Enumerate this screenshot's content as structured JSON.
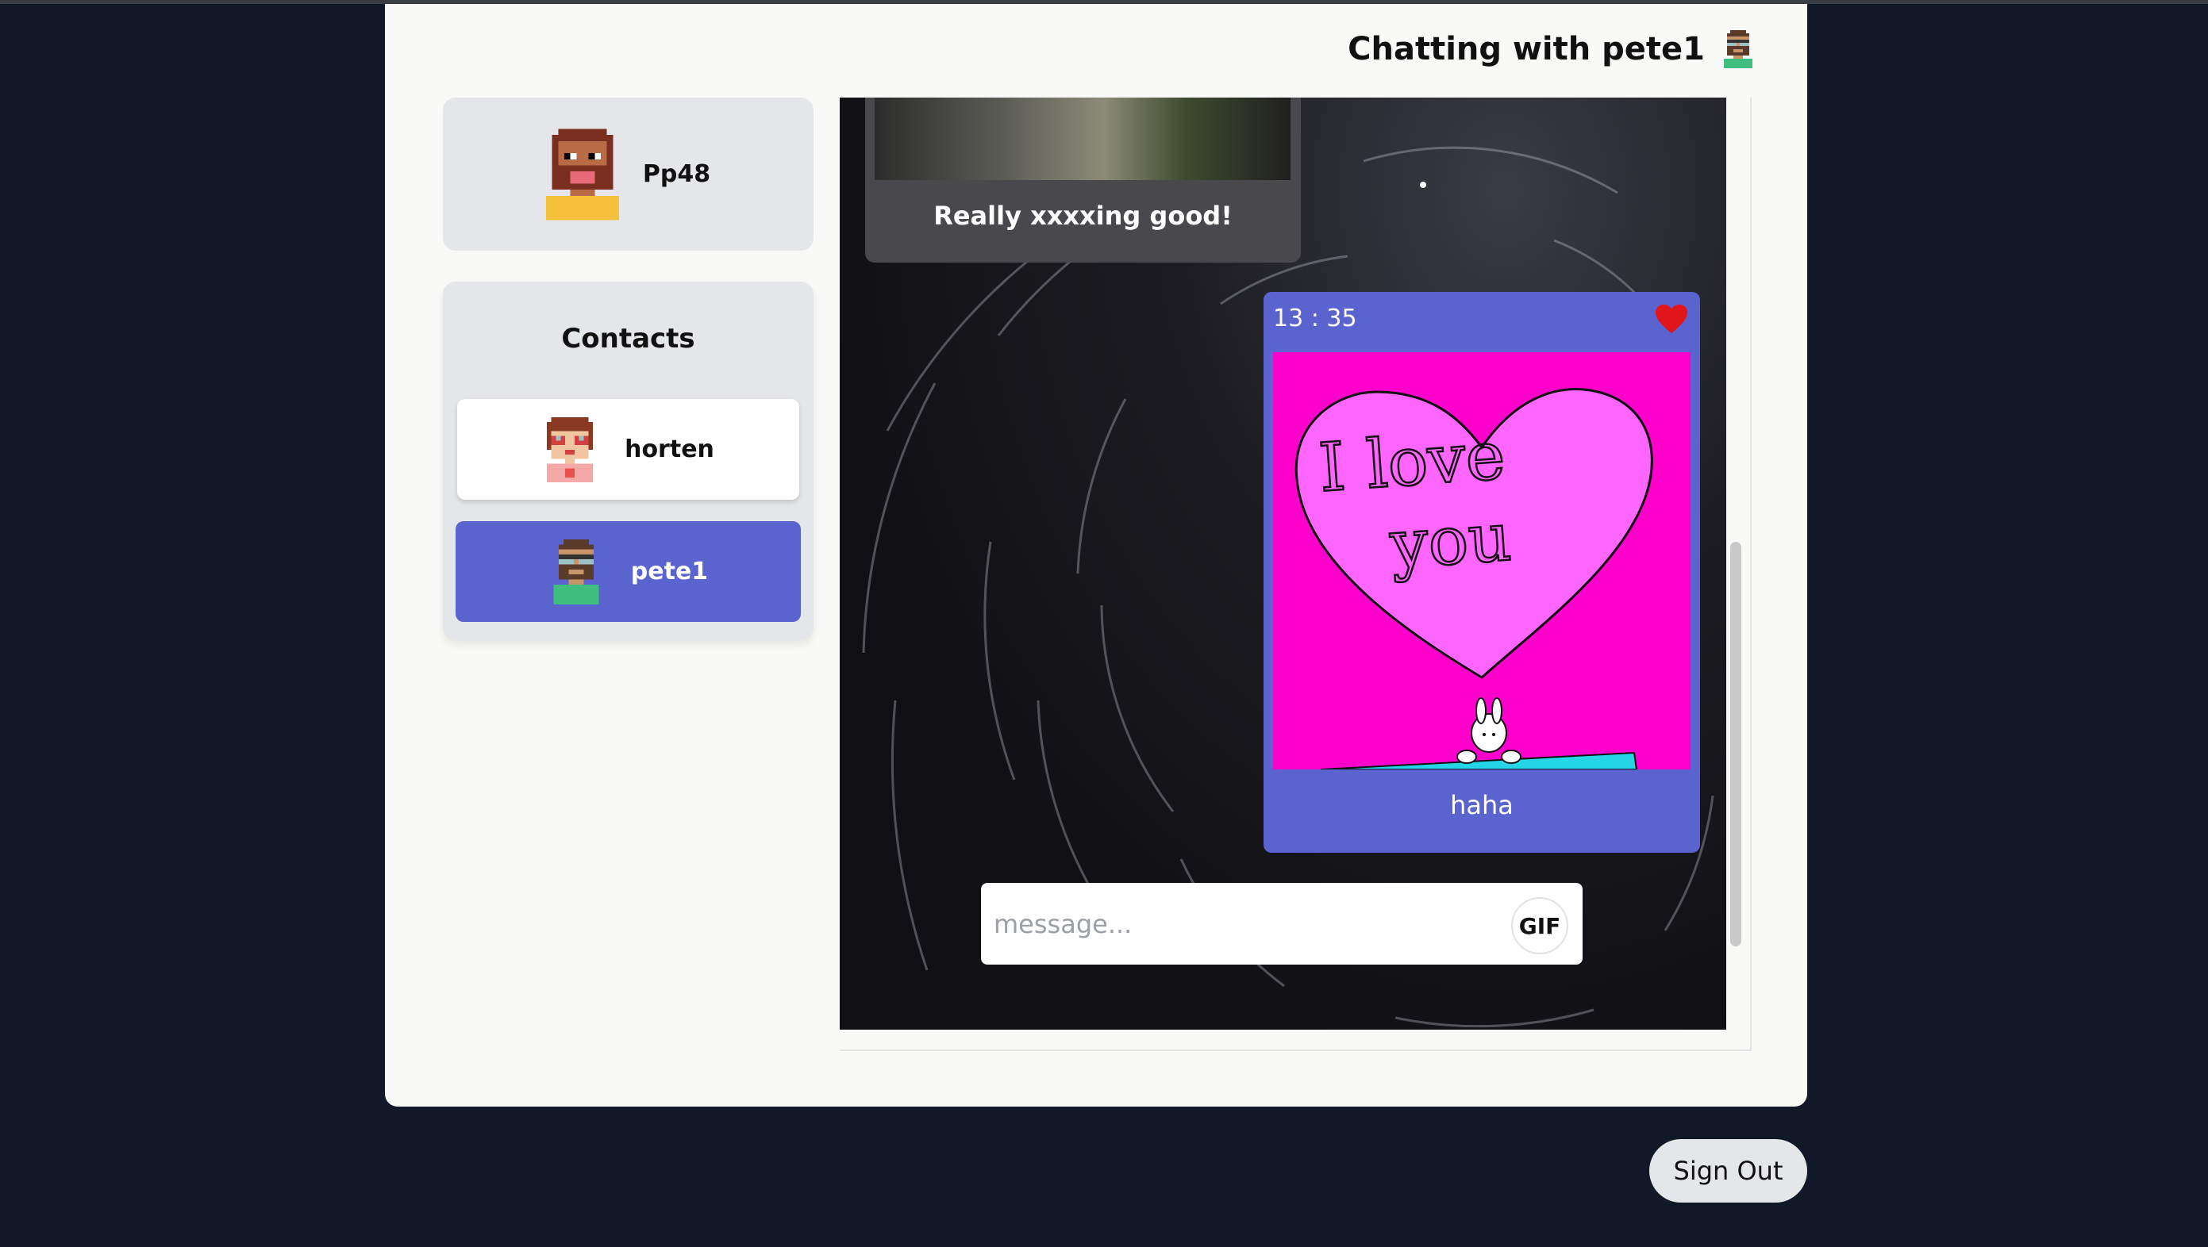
{
  "header": {
    "chat_title": "Chatting with pete1"
  },
  "profile": {
    "username": "Pp48"
  },
  "contacts": {
    "title": "Contacts",
    "items": [
      {
        "name": "horten",
        "selected": false
      },
      {
        "name": "pete1",
        "selected": true
      }
    ]
  },
  "messages": [
    {
      "text": "Really xxxxing good!"
    },
    {
      "time": "13 : 35",
      "caption": "haha",
      "liked": true,
      "gif_text_1": "I love",
      "gif_text_2": "you"
    }
  ],
  "composer": {
    "placeholder": "message...",
    "gif_label": "GIF"
  },
  "sign_out_label": "Sign Out",
  "colors": {
    "accent": "#5b63cf",
    "page_bg": "#111827",
    "card_bg": "#f9f9f7",
    "heart": "#e0161b",
    "gif_bg": "#ff00cc"
  }
}
